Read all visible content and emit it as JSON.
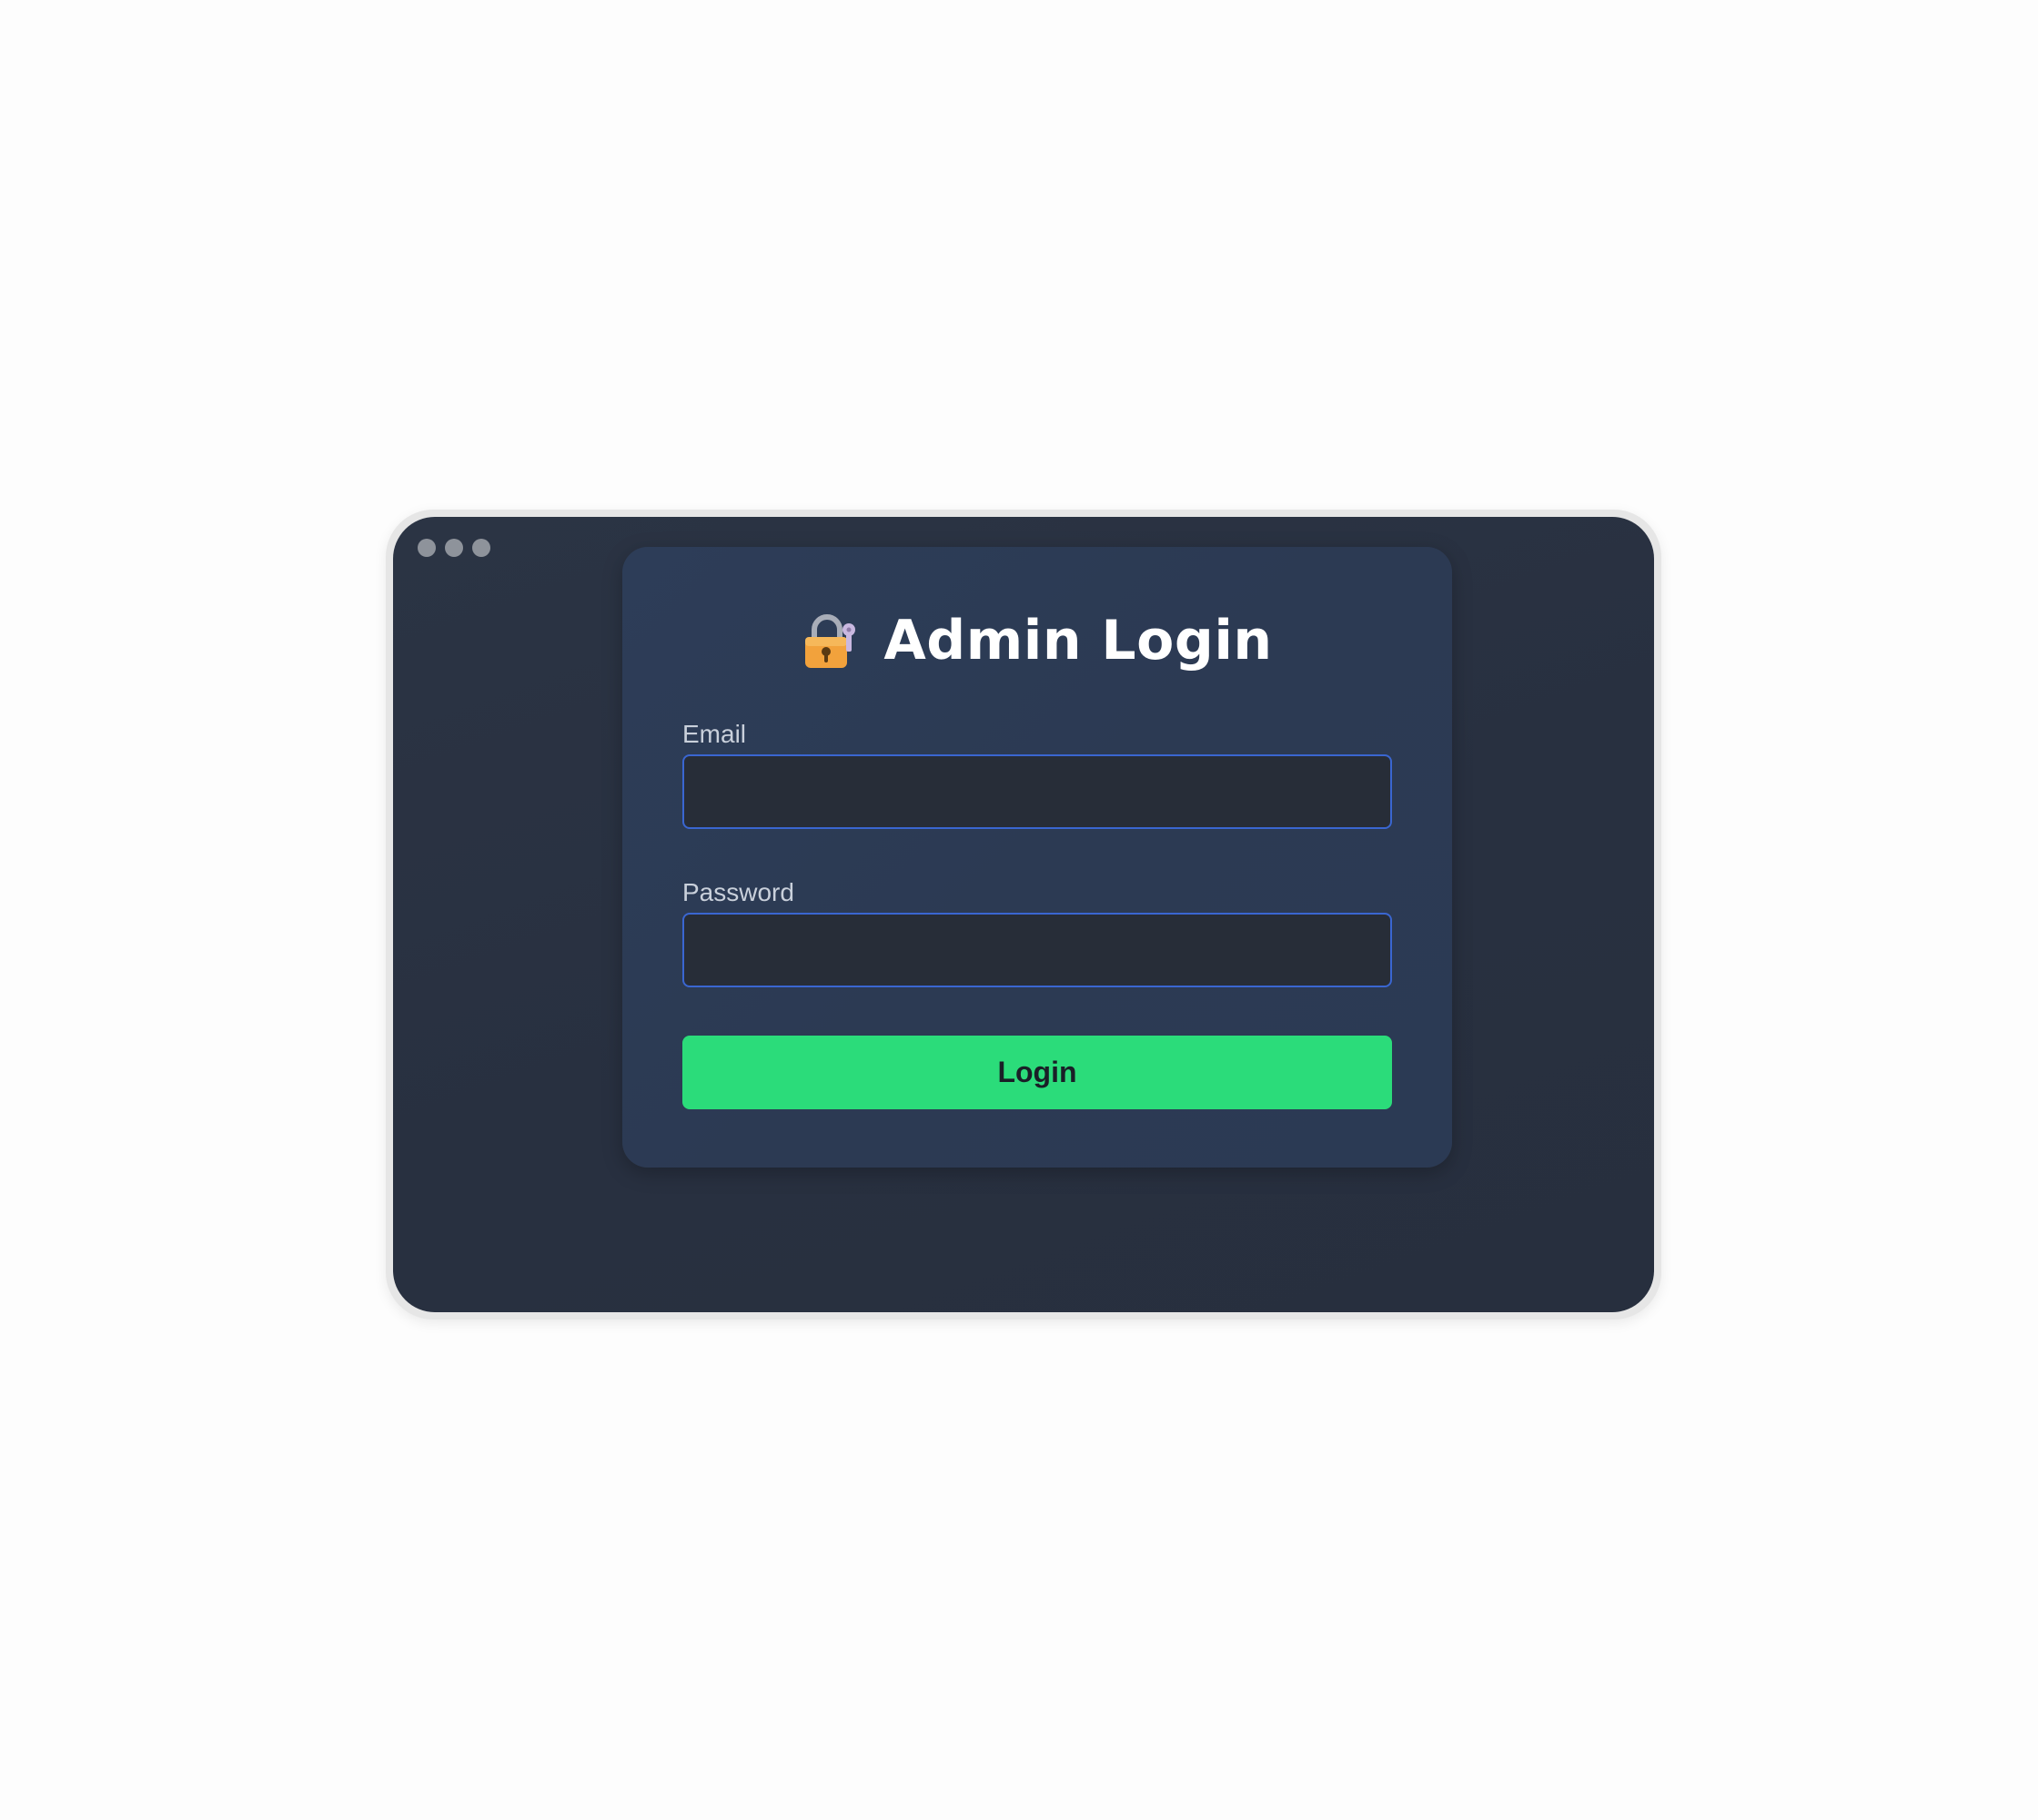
{
  "window": {
    "controls": [
      "dot",
      "dot",
      "dot"
    ]
  },
  "login": {
    "title": "Admin Login",
    "icon": "lock-with-key-icon",
    "email_label": "Email",
    "email_value": "",
    "email_placeholder": "",
    "password_label": "Password",
    "password_value": "",
    "password_placeholder": "",
    "submit_label": "Login"
  },
  "colors": {
    "window_bg": "#283040",
    "card_bg": "#2c3a53",
    "input_bg": "#272d38",
    "input_border": "#3a66d1",
    "button_bg": "#2bdc7a",
    "title": "#ffffff"
  }
}
